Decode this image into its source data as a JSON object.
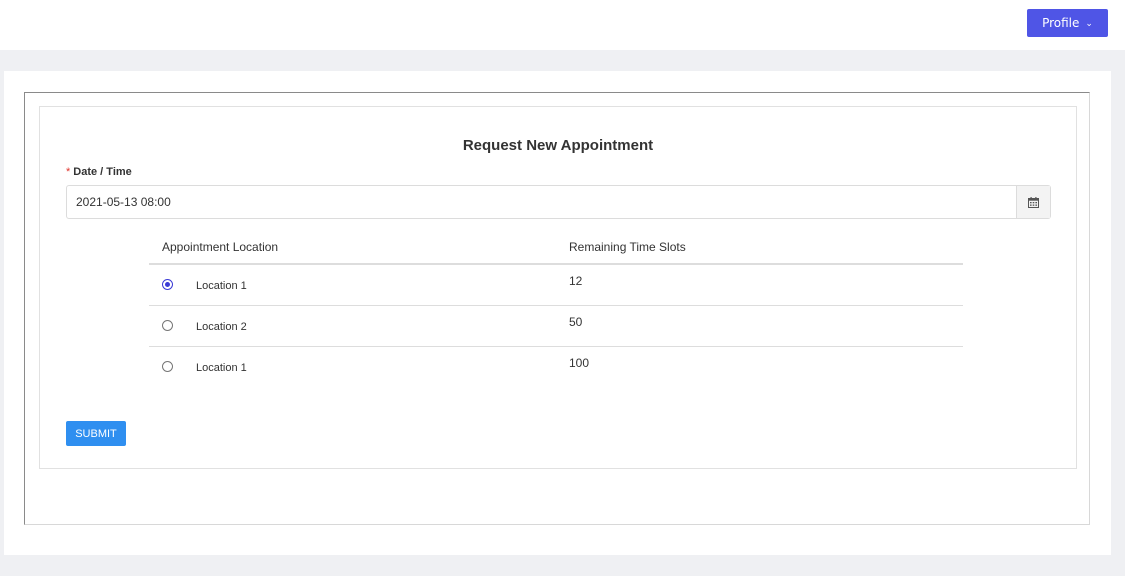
{
  "header": {
    "profile_label": "Profile",
    "profile_icon": "chevron-down-icon"
  },
  "form": {
    "title": "Request New Appointment",
    "datetime": {
      "required_marker": "*",
      "label": "Date / Time",
      "value": "2021-05-13 08:00",
      "icon": "calendar-icon"
    },
    "table": {
      "headers": [
        "Appointment Location",
        "Remaining Time Slots"
      ],
      "rows": [
        {
          "location": "Location 1",
          "slots": "12",
          "selected": true
        },
        {
          "location": "Location 2",
          "slots": "50",
          "selected": false
        },
        {
          "location": "Location 1",
          "slots": "100",
          "selected": false
        }
      ]
    },
    "submit_label": "SUBMIT"
  },
  "colors": {
    "profile_button": "#4f55e6",
    "submit_button": "#2f8ff0",
    "radio_selected": "#3b3bd6",
    "required_marker": "#e0342c",
    "page_background": "#eff0f3"
  }
}
